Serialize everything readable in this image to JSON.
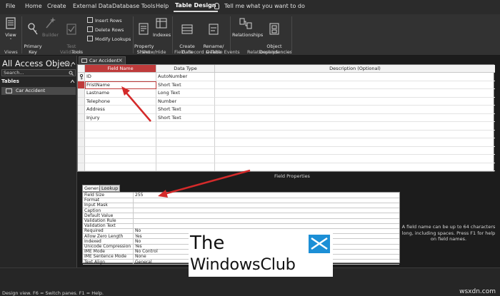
{
  "menu": {
    "tabs": [
      "File",
      "Home",
      "Create",
      "External Data",
      "Database Tools",
      "Help",
      "Table Design"
    ],
    "active": "Table Design",
    "tell_me": "Tell me what you want to do"
  },
  "ribbon": {
    "view": "View",
    "primary_key": "Primary\nKey",
    "builder": "Builder",
    "test_validation": "Test Validation\nRules",
    "insert_rows": "Insert Rows",
    "delete_rows": "Delete Rows",
    "modify_lookups": "Modify Lookups",
    "property_sheet": "Property\nSheet",
    "indexes": "Indexes",
    "create_data_macros": "Create Data\nMacros ˅",
    "rename_delete_macro": "Rename/\nDelete Macro",
    "relationships": "Relationships",
    "object_dependencies": "Object\nDependencies",
    "groups": {
      "views": "Views",
      "tools": "Tools",
      "show_hide": "Show/Hide",
      "field_events": "Field, Record & Table Events",
      "relationships": "Relationships"
    }
  },
  "nav": {
    "title": "All Access Obje...",
    "search_placeholder": "Search...",
    "section": "Tables",
    "items": [
      "Car Accident"
    ]
  },
  "document": {
    "tab_label": "Car Accident",
    "headers": {
      "field_name": "Field Name",
      "data_type": "Data Type",
      "description": "Description (Optional)"
    },
    "rows": [
      {
        "name": "ID",
        "type": "AutoNumber"
      },
      {
        "name": "FristName",
        "type": "Short Text"
      },
      {
        "name": "Lastname",
        "type": "Long Text"
      },
      {
        "name": "Telephone",
        "type": "Number"
      },
      {
        "name": "Address",
        "type": "Short Text"
      },
      {
        "name": "Injury",
        "type": "Short Text"
      }
    ],
    "field_properties_label": "Field Properties"
  },
  "properties": {
    "tabs": [
      "General",
      "Lookup"
    ],
    "rows": [
      {
        "label": "Field Size",
        "value": "255"
      },
      {
        "label": "Format",
        "value": ""
      },
      {
        "label": "Input Mask",
        "value": ""
      },
      {
        "label": "Caption",
        "value": ""
      },
      {
        "label": "Default Value",
        "value": ""
      },
      {
        "label": "Validation Rule",
        "value": ""
      },
      {
        "label": "Validation Text",
        "value": ""
      },
      {
        "label": "Required",
        "value": "No"
      },
      {
        "label": "Allow Zero Length",
        "value": "Yes"
      },
      {
        "label": "Indexed",
        "value": "No"
      },
      {
        "label": "Unicode Compression",
        "value": "Yes"
      },
      {
        "label": "IME Mode",
        "value": "No Control"
      },
      {
        "label": "IME Sentence Mode",
        "value": "None"
      },
      {
        "label": "Text Align",
        "value": "General"
      }
    ],
    "help_text": "A field name can be up to 64 characters long, including spaces. Press F1 for help on field names."
  },
  "status": {
    "text": "Design view.  F6 = Switch panes.  F1 = Help.",
    "site": "wsxdn.com"
  },
  "watermark": {
    "line1": "The",
    "line2": "WindowsClub"
  },
  "colors": {
    "accent_red": "#bf3b3b",
    "arrow_red": "#d42a2a",
    "logo_blue": "#1c8fd6"
  }
}
